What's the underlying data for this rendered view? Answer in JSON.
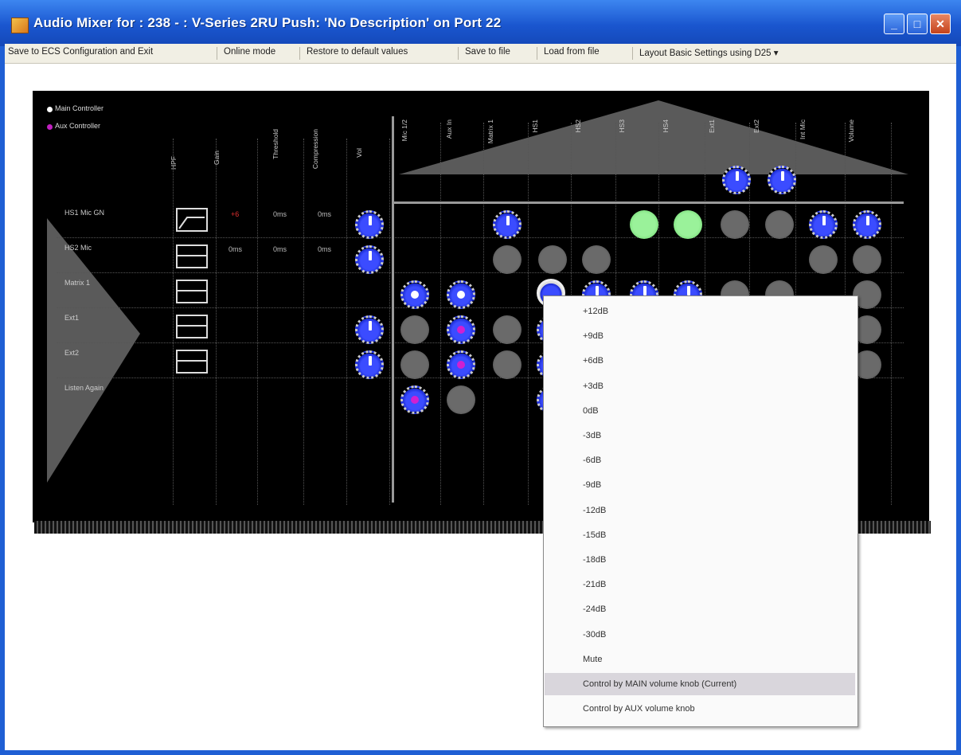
{
  "window": {
    "title": "Audio Mixer for : 238 - : V-Series 2RU Push: 'No Description' on Port 22",
    "minimize": "_",
    "maximize": "□",
    "close": "✕"
  },
  "menu": {
    "save_exit": "Save to ECS Configuration and Exit",
    "online": "Online mode",
    "restore": "Restore to default values",
    "save_file": "Save to file",
    "load_file": "Load from file",
    "layout": "Layout Basic Settings using D25 ▾"
  },
  "mixer": {
    "legend_main": "Main Controller",
    "legend_aux": "Aux Controller",
    "legend_main_color": "#ffffff",
    "legend_aux_color": "#c020c0",
    "input_columns": [
      "HPF",
      "Gain",
      "Threshold",
      "Compression",
      "Vol"
    ],
    "output_columns": [
      "Mic 1/2",
      "Aux In",
      "Matrix 1",
      "HS1",
      "HS2",
      "HS3",
      "HS4",
      "Ext1",
      "Ext2",
      "Int Mic",
      "Volume"
    ],
    "rows": [
      "HS1 Mic GN",
      "HS2 Mic",
      "Matrix 1",
      "Ext1",
      "Ext2",
      "Listen Again"
    ],
    "row_values": [
      {
        "gain": "+6",
        "threshold": "0ms",
        "compression": "0ms"
      },
      {
        "gain": "0ms",
        "threshold": "0ms",
        "compression": "0ms"
      }
    ]
  },
  "context_menu": {
    "items": [
      "+12dB",
      "+9dB",
      "+6dB",
      "+3dB",
      "0dB",
      "-3dB",
      "-6dB",
      "-9dB",
      "-12dB",
      "-15dB",
      "-18dB",
      "-21dB",
      "-24dB",
      "-30dB",
      "Mute",
      "Control by MAIN volume knob (Current)",
      "Control by AUX volume knob"
    ],
    "highlighted_index": 15
  }
}
